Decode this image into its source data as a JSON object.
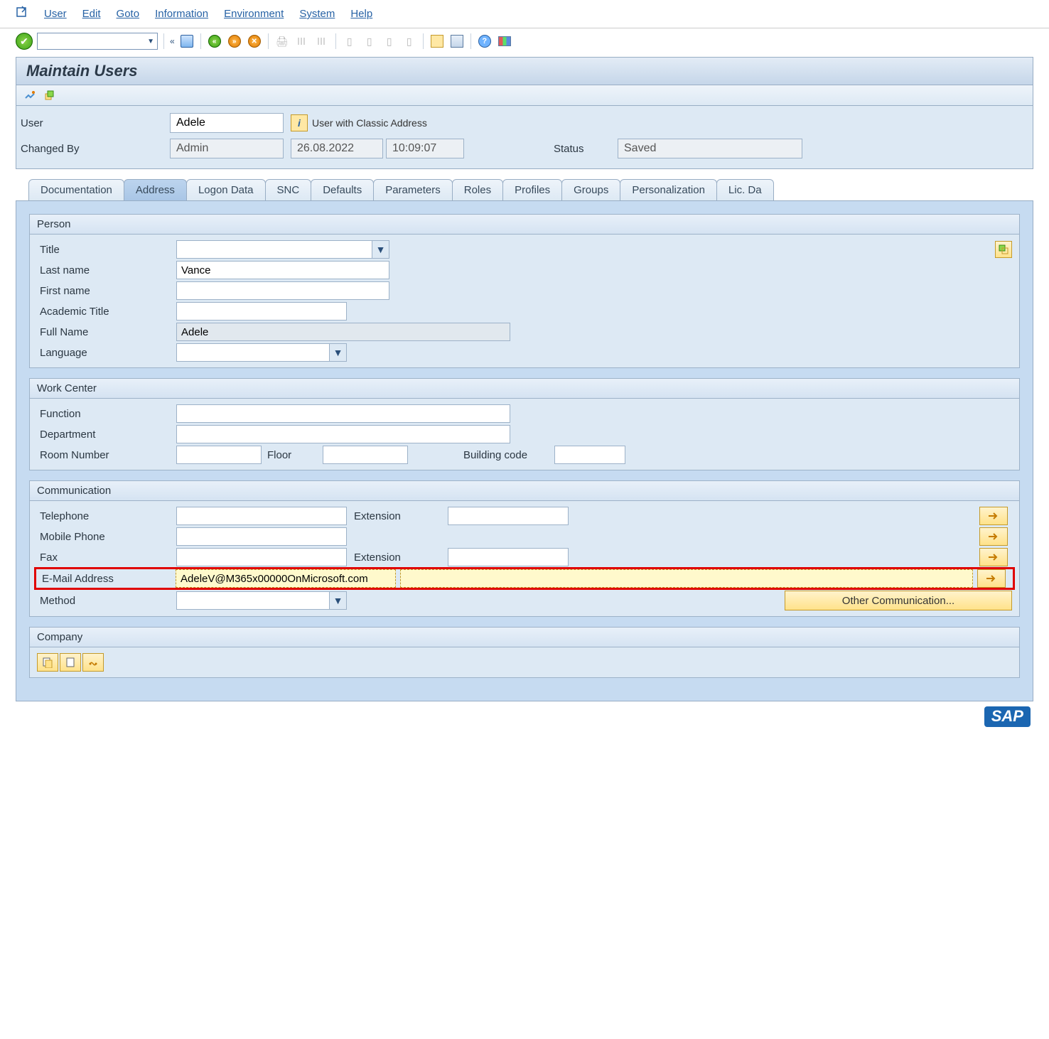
{
  "menu": {
    "items": [
      "User",
      "Edit",
      "Goto",
      "Information",
      "Environment",
      "System",
      "Help"
    ]
  },
  "title": "Maintain Users",
  "header": {
    "user_lbl": "User",
    "user_val": "Adele",
    "info_text": "User with Classic Address",
    "changed_lbl": "Changed By",
    "changed_val": "Admin",
    "date": "26.08.2022",
    "time": "10:09:07",
    "status_lbl": "Status",
    "status_val": "Saved"
  },
  "tabs": [
    "Documentation",
    "Address",
    "Logon Data",
    "SNC",
    "Defaults",
    "Parameters",
    "Roles",
    "Profiles",
    "Groups",
    "Personalization",
    "Lic. Da"
  ],
  "active_tab": 1,
  "person": {
    "head": "Person",
    "title_lbl": "Title",
    "title_val": "",
    "last_lbl": "Last name",
    "last_val": "Vance",
    "first_lbl": "First name",
    "first_val": "",
    "acad_lbl": "Academic Title",
    "acad_val": "",
    "full_lbl": "Full Name",
    "full_val": "Adele",
    "lang_lbl": "Language",
    "lang_val": ""
  },
  "work": {
    "head": "Work Center",
    "func_lbl": "Function",
    "func_val": "",
    "dept_lbl": "Department",
    "dept_val": "",
    "room_lbl": "Room Number",
    "room_val": "",
    "floor_lbl": "Floor",
    "floor_val": "",
    "bldg_lbl": "Building code",
    "bldg_val": ""
  },
  "comm": {
    "head": "Communication",
    "tel_lbl": "Telephone",
    "tel_val": "",
    "ext_lbl": "Extension",
    "tel_ext": "",
    "mob_lbl": "Mobile Phone",
    "mob_val": "",
    "fax_lbl": "Fax",
    "fax_val": "",
    "fax_ext": "",
    "email_lbl": "E-Mail Address",
    "email_val": "AdeleV@M365x00000OnMicrosoft.com",
    "method_lbl": "Method",
    "method_val": "",
    "other_btn": "Other Communication..."
  },
  "company": {
    "head": "Company"
  }
}
